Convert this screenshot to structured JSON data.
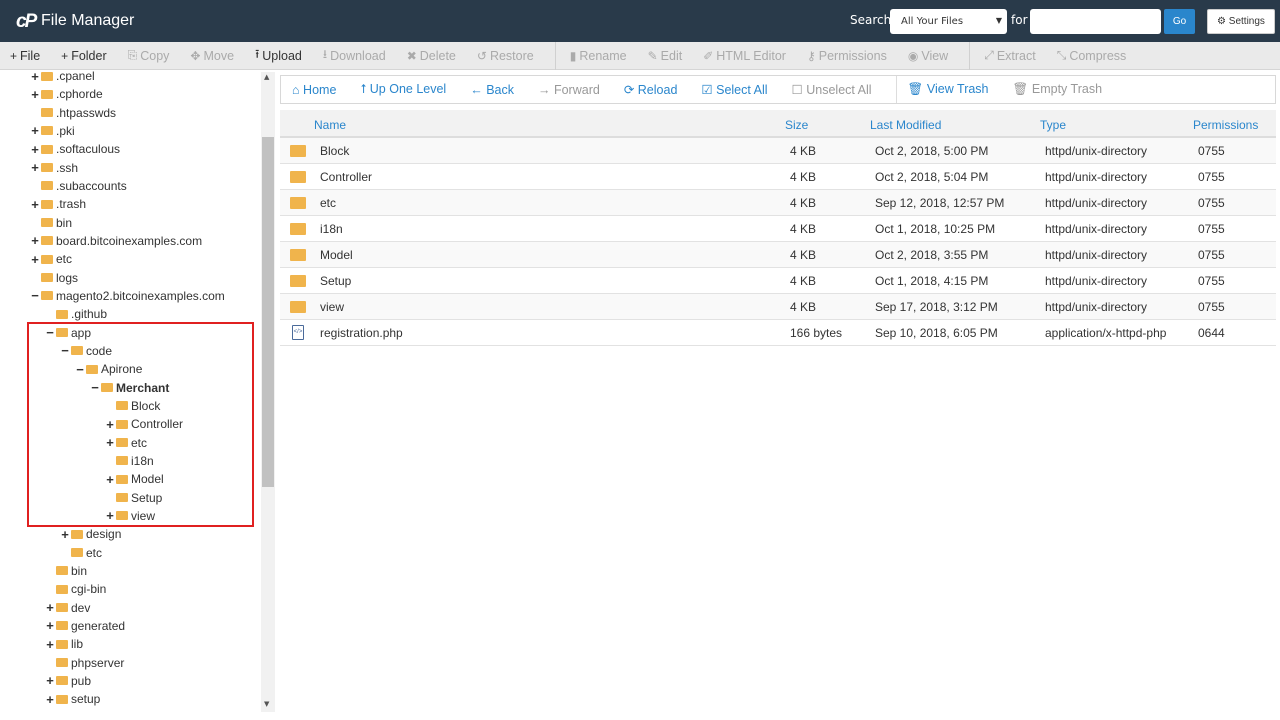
{
  "header": {
    "logo": "cP",
    "title": "File Manager",
    "search_label": "Search",
    "scope": "All Your Files",
    "for_label": "for",
    "search_value": "",
    "go": "Go",
    "settings": "Settings"
  },
  "toolbar": [
    {
      "icon": "+",
      "label": "File",
      "enabled": true
    },
    {
      "icon": "+",
      "label": "Folder",
      "enabled": true
    },
    {
      "icon": "⎘",
      "label": "Copy",
      "enabled": false
    },
    {
      "icon": "✥",
      "label": "Move",
      "enabled": false
    },
    {
      "icon": "⭱",
      "label": "Upload",
      "enabled": true
    },
    {
      "icon": "⭳",
      "label": "Download",
      "enabled": false
    },
    {
      "icon": "✖",
      "label": "Delete",
      "enabled": false
    },
    {
      "icon": "↺",
      "label": "Restore",
      "enabled": false
    },
    {
      "icon": "▮",
      "label": "Rename",
      "enabled": false,
      "sep": true
    },
    {
      "icon": "✎",
      "label": "Edit",
      "enabled": false
    },
    {
      "icon": "✐",
      "label": "HTML Editor",
      "enabled": false
    },
    {
      "icon": "⚷",
      "label": "Permissions",
      "enabled": false
    },
    {
      "icon": "◉",
      "label": "View",
      "enabled": false
    },
    {
      "icon": "⤢",
      "label": "Extract",
      "enabled": false,
      "sep": true
    },
    {
      "icon": "⤡",
      "label": "Compress",
      "enabled": false
    }
  ],
  "tree": [
    {
      "name": ".cpanel",
      "depth": 0,
      "exp": "+"
    },
    {
      "name": ".cphorde",
      "depth": 0,
      "exp": "+"
    },
    {
      "name": ".htpasswds",
      "depth": 0,
      "exp": ""
    },
    {
      "name": ".pki",
      "depth": 0,
      "exp": "+"
    },
    {
      "name": ".softaculous",
      "depth": 0,
      "exp": "+"
    },
    {
      "name": ".ssh",
      "depth": 0,
      "exp": "+"
    },
    {
      "name": ".subaccounts",
      "depth": 0,
      "exp": ""
    },
    {
      "name": ".trash",
      "depth": 0,
      "exp": "+"
    },
    {
      "name": "bin",
      "depth": 0,
      "exp": ""
    },
    {
      "name": "board.bitcoinexamples.com",
      "depth": 0,
      "exp": "+"
    },
    {
      "name": "etc",
      "depth": 0,
      "exp": "+"
    },
    {
      "name": "logs",
      "depth": 0,
      "exp": ""
    },
    {
      "name": "magento2.bitcoinexamples.com",
      "depth": 0,
      "exp": "−"
    },
    {
      "name": ".github",
      "depth": 1,
      "exp": ""
    },
    {
      "name": "app",
      "depth": 1,
      "exp": "−"
    },
    {
      "name": "code",
      "depth": 2,
      "exp": "−"
    },
    {
      "name": "Apirone",
      "depth": 3,
      "exp": "−"
    },
    {
      "name": "Merchant",
      "depth": 4,
      "exp": "−",
      "selected": true
    },
    {
      "name": "Block",
      "depth": 5,
      "exp": ""
    },
    {
      "name": "Controller",
      "depth": 5,
      "exp": "+"
    },
    {
      "name": "etc",
      "depth": 5,
      "exp": "+"
    },
    {
      "name": "i18n",
      "depth": 5,
      "exp": ""
    },
    {
      "name": "Model",
      "depth": 5,
      "exp": "+"
    },
    {
      "name": "Setup",
      "depth": 5,
      "exp": ""
    },
    {
      "name": "view",
      "depth": 5,
      "exp": "+"
    },
    {
      "name": "design",
      "depth": 2,
      "exp": "+"
    },
    {
      "name": "etc",
      "depth": 2,
      "exp": ""
    },
    {
      "name": "bin",
      "depth": 1,
      "exp": ""
    },
    {
      "name": "cgi-bin",
      "depth": 1,
      "exp": ""
    },
    {
      "name": "dev",
      "depth": 1,
      "exp": "+"
    },
    {
      "name": "generated",
      "depth": 1,
      "exp": "+"
    },
    {
      "name": "lib",
      "depth": 1,
      "exp": "+"
    },
    {
      "name": "phpserver",
      "depth": 1,
      "exp": ""
    },
    {
      "name": "pub",
      "depth": 1,
      "exp": "+"
    },
    {
      "name": "setup",
      "depth": 1,
      "exp": "+"
    }
  ],
  "nav": [
    {
      "icon": "⌂",
      "label": "Home",
      "enabled": true
    },
    {
      "icon": "⭡",
      "label": "Up One Level",
      "enabled": true
    },
    {
      "icon": "←",
      "label": "Back",
      "enabled": true
    },
    {
      "icon": "→",
      "label": "Forward",
      "enabled": false
    },
    {
      "icon": "⟳",
      "label": "Reload",
      "enabled": true
    },
    {
      "icon": "☑",
      "label": "Select All",
      "enabled": true
    },
    {
      "icon": "☐",
      "label": "Unselect All",
      "enabled": false
    },
    {
      "icon": "🗑",
      "label": "View Trash",
      "enabled": true,
      "sep": true
    },
    {
      "icon": "🗑",
      "label": "Empty Trash",
      "enabled": false
    }
  ],
  "columns": [
    "Name",
    "Size",
    "Last Modified",
    "Type",
    "Permissions"
  ],
  "files": [
    {
      "name": "Block",
      "size": "4 KB",
      "modified": "Oct 2, 2018, 5:00 PM",
      "type": "httpd/unix-directory",
      "perms": "0755",
      "icon": "folder"
    },
    {
      "name": "Controller",
      "size": "4 KB",
      "modified": "Oct 2, 2018, 5:04 PM",
      "type": "httpd/unix-directory",
      "perms": "0755",
      "icon": "folder"
    },
    {
      "name": "etc",
      "size": "4 KB",
      "modified": "Sep 12, 2018, 12:57 PM",
      "type": "httpd/unix-directory",
      "perms": "0755",
      "icon": "folder"
    },
    {
      "name": "i18n",
      "size": "4 KB",
      "modified": "Oct 1, 2018, 10:25 PM",
      "type": "httpd/unix-directory",
      "perms": "0755",
      "icon": "folder"
    },
    {
      "name": "Model",
      "size": "4 KB",
      "modified": "Oct 2, 2018, 3:55 PM",
      "type": "httpd/unix-directory",
      "perms": "0755",
      "icon": "folder"
    },
    {
      "name": "Setup",
      "size": "4 KB",
      "modified": "Oct 1, 2018, 4:15 PM",
      "type": "httpd/unix-directory",
      "perms": "0755",
      "icon": "folder"
    },
    {
      "name": "view",
      "size": "4 KB",
      "modified": "Sep 17, 2018, 3:12 PM",
      "type": "httpd/unix-directory",
      "perms": "0755",
      "icon": "folder"
    },
    {
      "name": "registration.php",
      "size": "166 bytes",
      "modified": "Sep 10, 2018, 6:05 PM",
      "type": "application/x-httpd-php",
      "perms": "0644",
      "icon": "php-file"
    }
  ],
  "colors": {
    "header_bg": "#293a4a",
    "accent": "#2a86cc",
    "folder": "#f0b44c",
    "highlight": "#e02020"
  }
}
